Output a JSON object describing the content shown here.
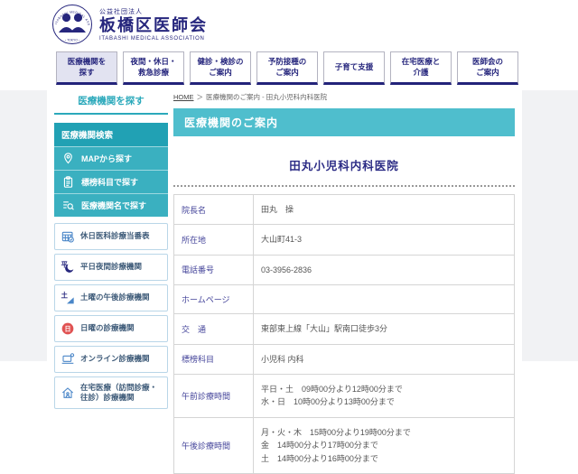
{
  "colors": {
    "navy": "#26267d",
    "teal_banner": "#4fbecd",
    "teal_panel_header": "#21a1b4",
    "teal_panel_item": "#3ab0c0",
    "active_nav_bg": "#e2e3f1",
    "sunday_red": "#e05252",
    "icon_blue": "#4a86c8"
  },
  "header": {
    "org_type": "公益社団法人",
    "org_name": "板橋区医師会",
    "org_name_en": "ITABASHI MEDICAL ASSOCIATION",
    "logo": {
      "ring_top": "ITABASHI MEDICAL ASSOCIATION",
      "ring_bottom": "・TOKYO・"
    }
  },
  "nav": {
    "items": [
      {
        "label": "医療機関を\n探す",
        "active": true
      },
      {
        "label": "夜間・休日・\n救急診療",
        "active": false
      },
      {
        "label": "健診・検診の\nご案内",
        "active": false
      },
      {
        "label": "予防接種の\nご案内",
        "active": false
      },
      {
        "label": "子育て支援",
        "active": false
      },
      {
        "label": "在宅医療と\n介護",
        "active": false
      },
      {
        "label": "医師会の\nご案内",
        "active": false
      }
    ]
  },
  "breadcrumb": {
    "home": "HOME",
    "separator": "＞",
    "trail": "医療機関のご案内 - 田丸小児科内科医院"
  },
  "sidebar": {
    "title": "医療機関を探す",
    "search_panel": {
      "header": "医療機関検索",
      "items": [
        {
          "label": "MAPから探す",
          "icon": "map-pin-icon"
        },
        {
          "label": "標榜科目で探す",
          "icon": "clipboard-icon"
        },
        {
          "label": "医療機関名で探す",
          "icon": "list-search-icon"
        }
      ]
    },
    "links": [
      {
        "label": "休日医科診療当番表",
        "icon": "calendar-check-icon"
      },
      {
        "label": "平日夜間診療機関",
        "icon": "weekday-night-icon"
      },
      {
        "label": "土曜の午後診療機関",
        "icon": "saturday-afternoon-icon"
      },
      {
        "label": "日曜の診療機関",
        "icon": "sunday-icon"
      },
      {
        "label": "オンライン診療機関",
        "icon": "online-care-icon"
      },
      {
        "label": "在宅医療（訪問診療・往診）診療機関",
        "icon": "home-care-icon"
      }
    ]
  },
  "main": {
    "banner": "医療機関のご案内",
    "clinic_title": "田丸小児科内科医院",
    "table": {
      "rows": [
        {
          "label": "院長名",
          "value": "田丸　操"
        },
        {
          "label": "所在地",
          "value": "大山町41-3"
        },
        {
          "label": "電話番号",
          "value": "03-3956-2836"
        },
        {
          "label": "ホームページ",
          "value": ""
        },
        {
          "label": "交　通",
          "value": "東部東上線「大山」駅南口徒歩3分"
        },
        {
          "label": "標榜科目",
          "value": "小児科 内科"
        },
        {
          "label": "午前診療時間",
          "value": "平日・土　09時00分より12時00分まで\n水・日　10時00分より13時00分まで"
        },
        {
          "label": "午後診療時間",
          "value": "月・火・木　15時00分より19時00分まで\n金　14時00分より17時00分まで\n土　14時00分より16時00分まで"
        }
      ]
    }
  }
}
